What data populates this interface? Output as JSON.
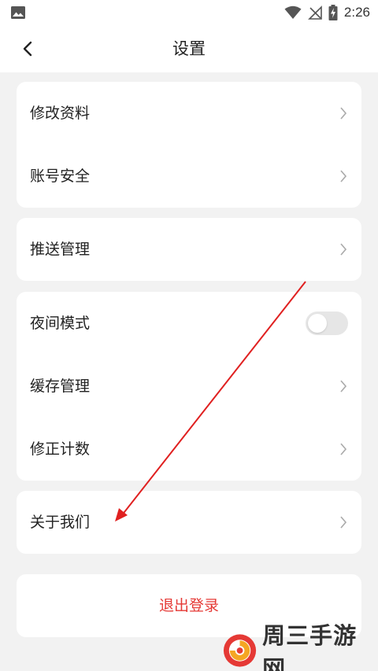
{
  "status_bar": {
    "time": "2:26",
    "icons": [
      "image-icon",
      "wifi-icon",
      "no-sim-icon",
      "battery-charging-icon"
    ]
  },
  "header": {
    "title": "设置",
    "back_icon": "chevron-left-icon"
  },
  "groups": [
    {
      "items": [
        {
          "label": "修改资料"
        },
        {
          "label": "账号安全"
        }
      ]
    },
    {
      "items": [
        {
          "label": "推送管理"
        }
      ]
    },
    {
      "items": [
        {
          "label": "夜间模式",
          "toggle": true,
          "toggle_on": false
        },
        {
          "label": "缓存管理"
        },
        {
          "label": "修正计数"
        }
      ]
    },
    {
      "items": [
        {
          "label": "关于我们"
        }
      ]
    }
  ],
  "logout": {
    "label": "退出登录",
    "color": "#e53935"
  },
  "annotation": {
    "arrow_color": "#e02020"
  },
  "watermark": {
    "text": "周三手游网",
    "logo_colors": [
      "#e53935",
      "#f5a623"
    ]
  },
  "colors": {
    "background": "#f2f2f2",
    "card": "#ffffff",
    "text": "#222222",
    "chevron": "#aaaaaa"
  }
}
